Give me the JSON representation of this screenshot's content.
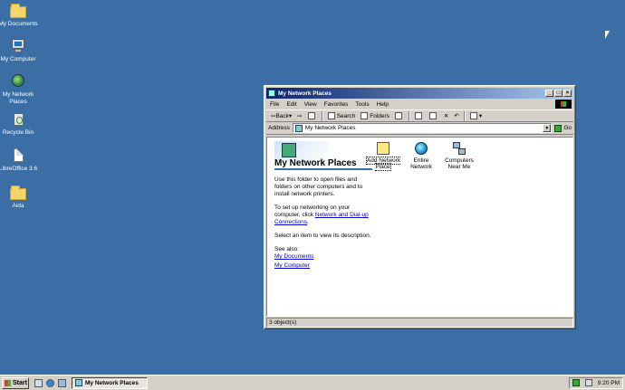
{
  "desktop": {
    "icons": [
      {
        "label": "My Documents"
      },
      {
        "label": "My Computer"
      },
      {
        "label": "My Network Places"
      },
      {
        "label": "Recycle Bin"
      },
      {
        "label": "LibreOffice 3.6"
      },
      {
        "label": "Aida"
      }
    ]
  },
  "window": {
    "title": "My Network Places",
    "menu": [
      "File",
      "Edit",
      "View",
      "Favorites",
      "Tools",
      "Help"
    ],
    "toolbar": {
      "back": "Back",
      "search": "Search",
      "folders": "Folders"
    },
    "address": {
      "label": "Address",
      "value": "My Network Places",
      "go": "Go"
    },
    "leftpane": {
      "title": "My Network Places",
      "p1": "Use this folder to open files and folders on other computers and to install network printers.",
      "p2_prefix": "To set up networking on your computer, click ",
      "p2_link": "Network and Dial-up Connections",
      "p2_suffix": ".",
      "p3": "Select an item to view its description.",
      "see_also": "See also:",
      "links": [
        "My Documents",
        "My Computer"
      ]
    },
    "items": [
      {
        "label": "Add Network Place"
      },
      {
        "label": "Entire Network"
      },
      {
        "label": "Computers Near Me"
      }
    ],
    "status": "3 object(s)"
  },
  "taskbar": {
    "start": "Start",
    "task": "My Network Places",
    "clock": "9:20 PM"
  }
}
